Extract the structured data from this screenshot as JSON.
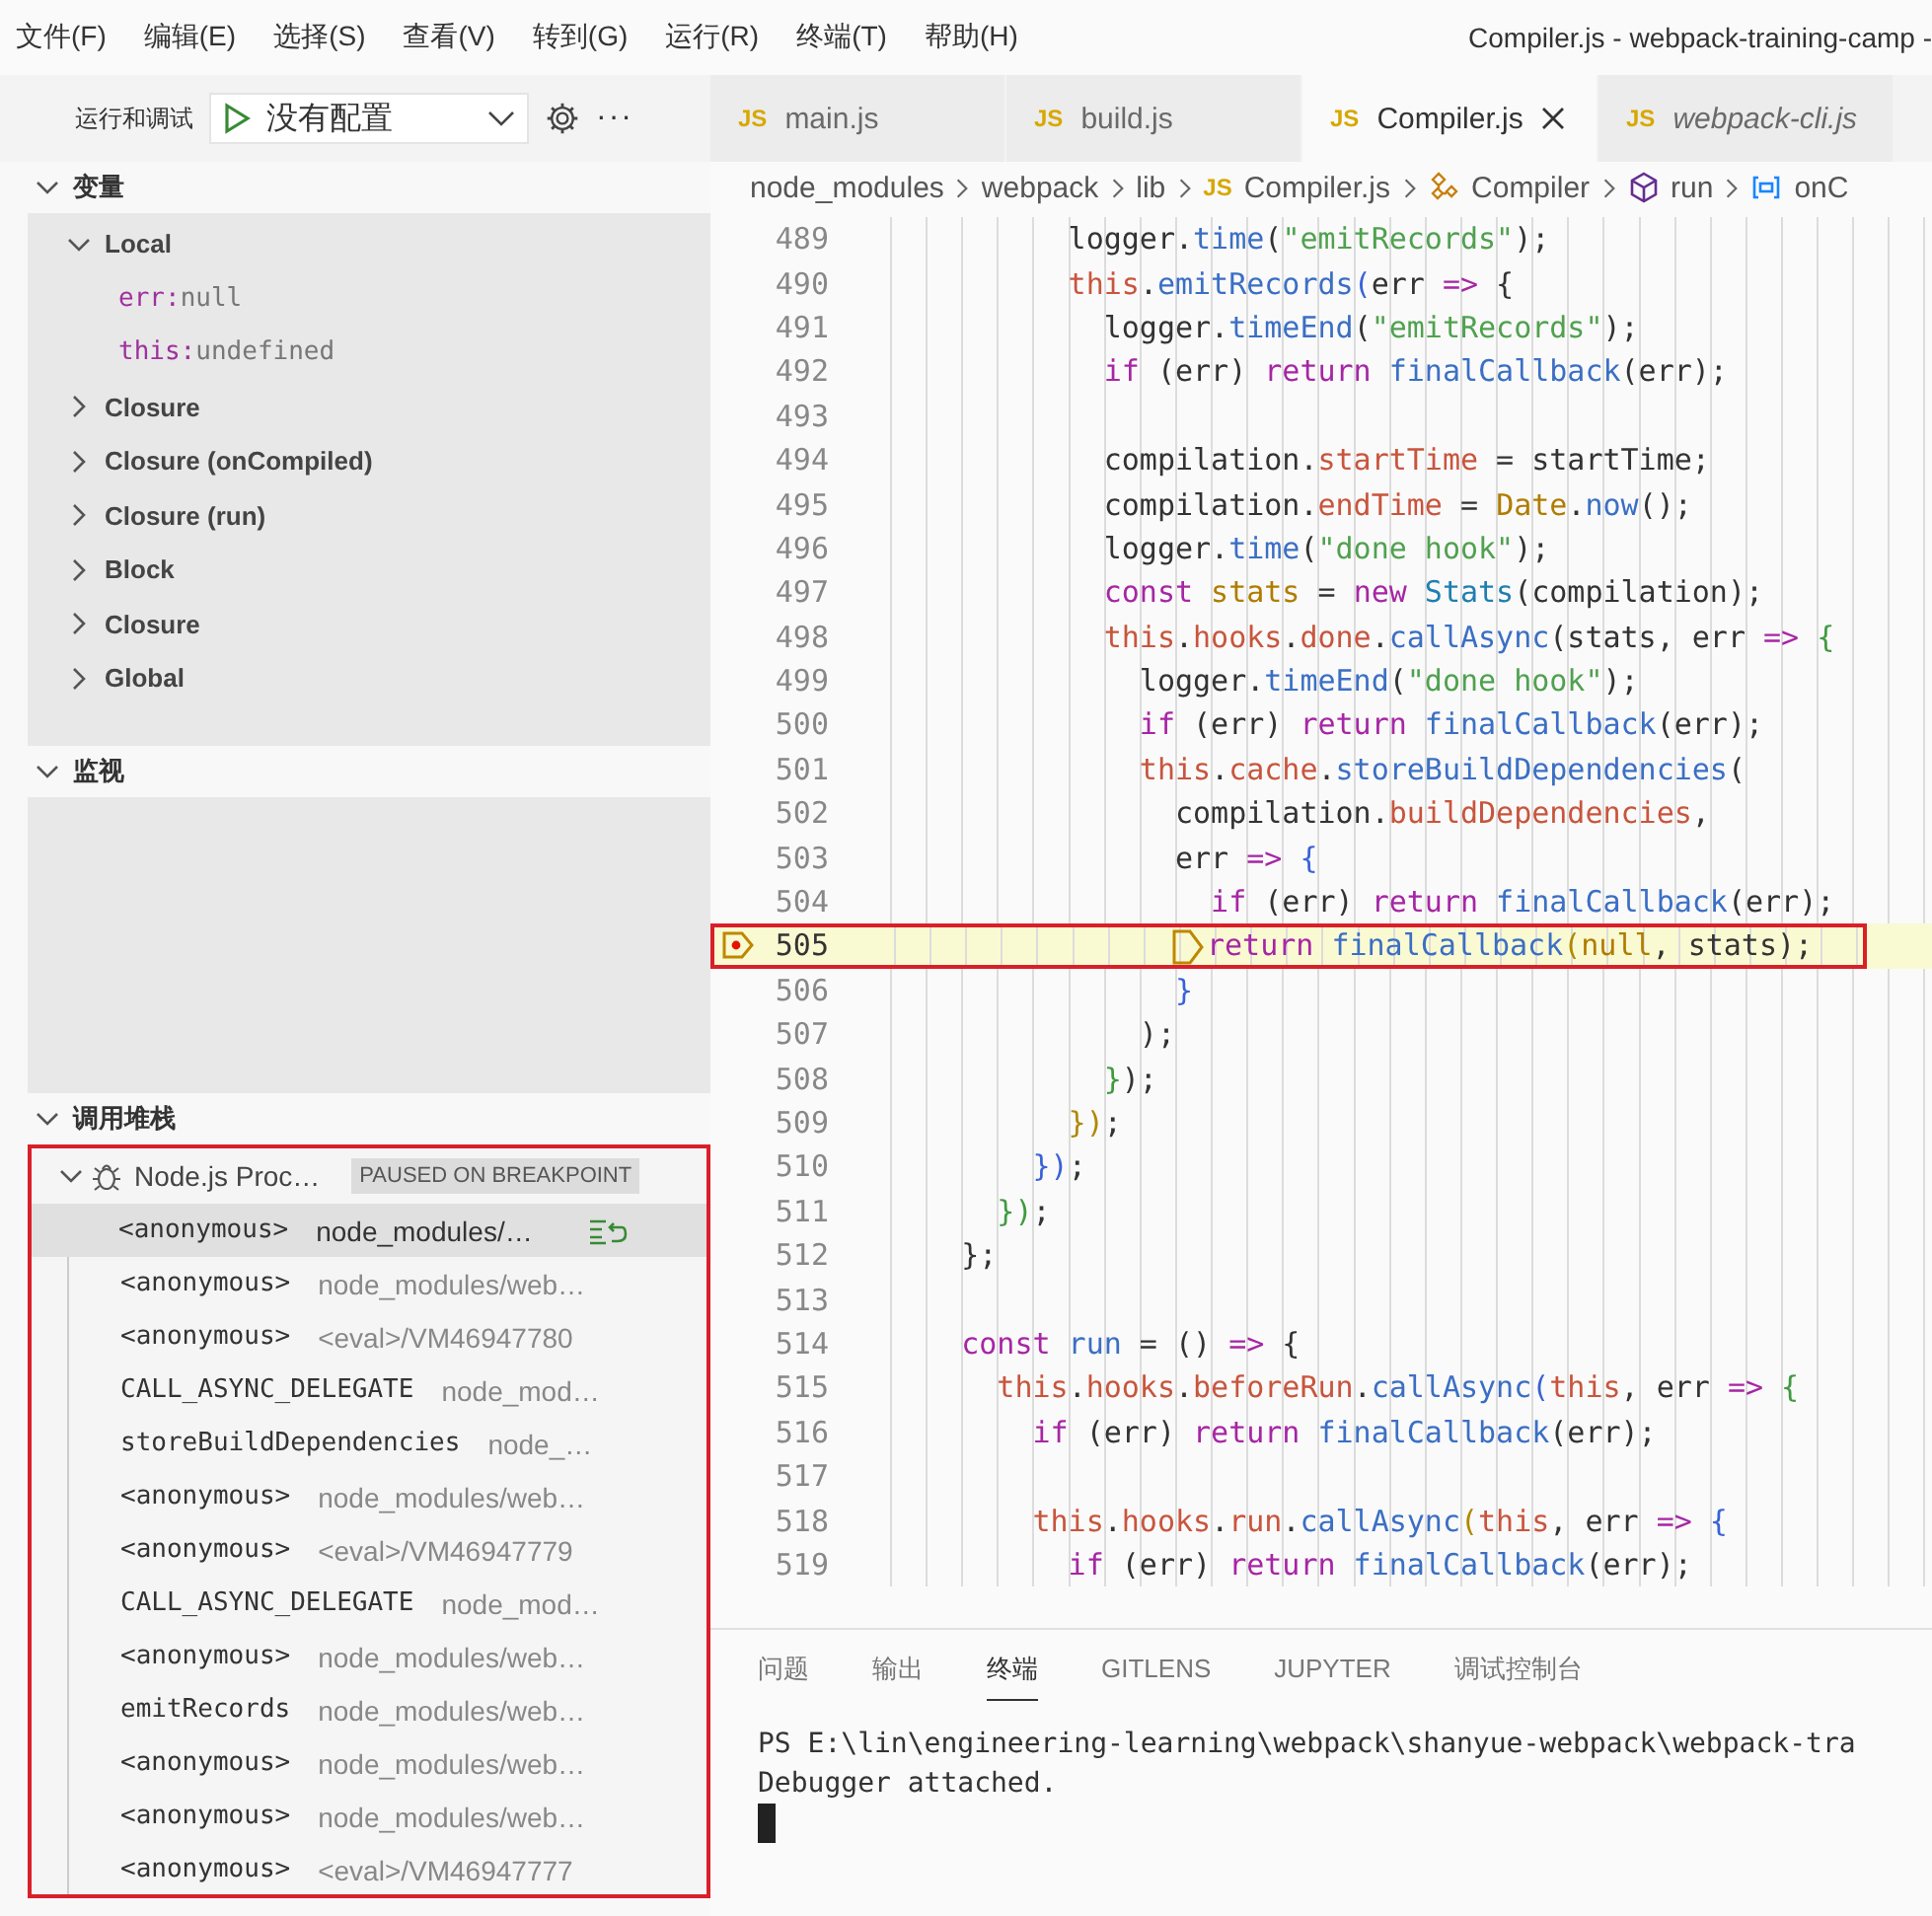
{
  "menu_bar": {
    "items": [
      "文件(F)",
      "编辑(E)",
      "选择(S)",
      "查看(V)",
      "转到(G)",
      "运行(R)",
      "终端(T)",
      "帮助(H)"
    ],
    "title": "Compiler.js - webpack-training-camp -"
  },
  "debug_toolbar": {
    "label": "运行和调试",
    "configuration": "没有配置",
    "more": "···"
  },
  "tabs": [
    {
      "badge": "JS",
      "label": "main.js",
      "selected": false,
      "preview": false
    },
    {
      "badge": "JS",
      "label": "build.js",
      "selected": false,
      "preview": false
    },
    {
      "badge": "JS",
      "label": "Compiler.js",
      "selected": true,
      "preview": false
    },
    {
      "badge": "JS",
      "label": "webpack-cli.js",
      "selected": false,
      "preview": true
    }
  ],
  "breadcrumbs": [
    {
      "kind": "folder",
      "label": "node_modules"
    },
    {
      "kind": "folder",
      "label": "webpack"
    },
    {
      "kind": "folder",
      "label": "lib"
    },
    {
      "kind": "file",
      "badge": "JS",
      "label": "Compiler.js"
    },
    {
      "kind": "class",
      "label": "Compiler"
    },
    {
      "kind": "method",
      "label": "run"
    },
    {
      "kind": "variable",
      "label": "onC"
    }
  ],
  "sidebar": {
    "variables": {
      "title": "变量",
      "expanded": true,
      "scopes": [
        {
          "label": "Local",
          "expanded": true,
          "children": [
            {
              "name": "err:",
              "value": "null"
            },
            {
              "name": "this:",
              "value": "undefined"
            }
          ]
        },
        {
          "label": "Closure",
          "expanded": false
        },
        {
          "label": "Closure (onCompiled)",
          "expanded": false
        },
        {
          "label": "Closure (run)",
          "expanded": false
        },
        {
          "label": "Block",
          "expanded": false
        },
        {
          "label": "Closure",
          "expanded": false
        },
        {
          "label": "Global",
          "expanded": false
        }
      ]
    },
    "watch": {
      "title": "监视",
      "expanded": true
    },
    "call_stack": {
      "title": "调用堆栈",
      "expanded": true,
      "session": {
        "label": "Node.js Proc…",
        "status": "PAUSED ON BREAKPOINT",
        "expanded": true
      },
      "frames": [
        {
          "name": "<anonymous>",
          "source": "node_modules/…",
          "selected": true
        },
        {
          "name": "<anonymous>",
          "source": "node_modules/web…",
          "selected": false
        },
        {
          "name": "<anonymous>",
          "source": "<eval>/VM46947780",
          "selected": false
        },
        {
          "name": "CALL_ASYNC_DELEGATE",
          "source": "node_mod…",
          "selected": false
        },
        {
          "name": "storeBuildDependencies",
          "source": "node_…",
          "selected": false
        },
        {
          "name": "<anonymous>",
          "source": "node_modules/web…",
          "selected": false
        },
        {
          "name": "<anonymous>",
          "source": "<eval>/VM46947779",
          "selected": false
        },
        {
          "name": "CALL_ASYNC_DELEGATE",
          "source": "node_mod…",
          "selected": false
        },
        {
          "name": "<anonymous>",
          "source": "node_modules/web…",
          "selected": false
        },
        {
          "name": "emitRecords",
          "source": "node_modules/web…",
          "selected": false
        },
        {
          "name": "<anonymous>",
          "source": "node_modules/web…",
          "selected": false
        },
        {
          "name": "<anonymous>",
          "source": "node_modules/web…",
          "selected": false
        },
        {
          "name": "<anonymous>",
          "source": "<eval>/VM46947777",
          "selected": false
        }
      ]
    }
  },
  "editor": {
    "lines": [
      {
        "no": "489",
        "current": false,
        "tokens": [
          {
            "text": "          logger.",
            "kind": "p"
          },
          {
            "text": "time",
            "kind": "f"
          },
          {
            "text": "(",
            "kind": "p"
          },
          {
            "text": "\"emitRecords\"",
            "kind": "s"
          },
          {
            "text": ");",
            "kind": "p"
          }
        ]
      },
      {
        "no": "490",
        "current": false,
        "tokens": [
          {
            "text": "          this",
            "kind": "t"
          },
          {
            "text": ".",
            "kind": "p"
          },
          {
            "text": "emitRecords",
            "kind": "f"
          },
          {
            "text": "(",
            "kind": "b"
          },
          {
            "text": "err ",
            "kind": "p"
          },
          {
            "text": "=>",
            "kind": "k"
          },
          {
            "text": " {",
            "kind": "p"
          }
        ]
      },
      {
        "no": "491",
        "current": false,
        "tokens": [
          {
            "text": "            logger.",
            "kind": "p"
          },
          {
            "text": "timeEnd",
            "kind": "f"
          },
          {
            "text": "(",
            "kind": "p"
          },
          {
            "text": "\"emitRecords\"",
            "kind": "s"
          },
          {
            "text": ");",
            "kind": "p"
          }
        ]
      },
      {
        "no": "492",
        "current": false,
        "tokens": [
          {
            "text": "            if",
            "kind": "k"
          },
          {
            "text": " (err) ",
            "kind": "p"
          },
          {
            "text": "return",
            "kind": "k"
          },
          {
            "text": " finalCallback",
            "kind": "f"
          },
          {
            "text": "(err);",
            "kind": "p"
          }
        ]
      },
      {
        "no": "493",
        "current": false
      },
      {
        "no": "494",
        "current": false,
        "tokens": [
          {
            "text": "            compilation.",
            "kind": "p"
          },
          {
            "text": "startTime",
            "kind": "t"
          },
          {
            "text": " = startTime;",
            "kind": "p"
          }
        ]
      },
      {
        "no": "495",
        "current": false,
        "tokens": [
          {
            "text": "            compilation.",
            "kind": "p"
          },
          {
            "text": "endTime",
            "kind": "t"
          },
          {
            "text": " = ",
            "kind": "p"
          },
          {
            "text": "Date",
            "kind": "c"
          },
          {
            "text": ".",
            "kind": "p"
          },
          {
            "text": "now",
            "kind": "f"
          },
          {
            "text": "();",
            "kind": "p"
          }
        ]
      },
      {
        "no": "496",
        "current": false,
        "tokens": [
          {
            "text": "            logger.",
            "kind": "p"
          },
          {
            "text": "time",
            "kind": "f"
          },
          {
            "text": "(",
            "kind": "p"
          },
          {
            "text": "\"done hook\"",
            "kind": "s"
          },
          {
            "text": ");",
            "kind": "p"
          }
        ]
      },
      {
        "no": "497",
        "current": false,
        "tokens": [
          {
            "text": "            const",
            "kind": "k"
          },
          {
            "text": " stats",
            "kind": "c"
          },
          {
            "text": " = ",
            "kind": "p"
          },
          {
            "text": "new",
            "kind": "k"
          },
          {
            "text": " Stats",
            "kind": "y"
          },
          {
            "text": "(compilation);",
            "kind": "p"
          }
        ]
      },
      {
        "no": "498",
        "current": false,
        "tokens": [
          {
            "text": "            this",
            "kind": "t"
          },
          {
            "text": ".",
            "kind": "p"
          },
          {
            "text": "hooks",
            "kind": "t"
          },
          {
            "text": ".",
            "kind": "p"
          },
          {
            "text": "done",
            "kind": "t"
          },
          {
            "text": ".",
            "kind": "p"
          },
          {
            "text": "callAsync",
            "kind": "f"
          },
          {
            "text": "(stats, err ",
            "kind": "p"
          },
          {
            "text": "=>",
            "kind": "k"
          },
          {
            "text": " {",
            "kind": "g"
          }
        ]
      },
      {
        "no": "499",
        "current": false,
        "tokens": [
          {
            "text": "              logger.",
            "kind": "p"
          },
          {
            "text": "timeEnd",
            "kind": "f"
          },
          {
            "text": "(",
            "kind": "p"
          },
          {
            "text": "\"done hook\"",
            "kind": "s"
          },
          {
            "text": ");",
            "kind": "p"
          }
        ]
      },
      {
        "no": "500",
        "current": false,
        "tokens": [
          {
            "text": "              if",
            "kind": "k"
          },
          {
            "text": " (err) ",
            "kind": "p"
          },
          {
            "text": "return",
            "kind": "k"
          },
          {
            "text": " finalCallback",
            "kind": "f"
          },
          {
            "text": "(err);",
            "kind": "p"
          }
        ]
      },
      {
        "no": "501",
        "current": false,
        "tokens": [
          {
            "text": "              this",
            "kind": "t"
          },
          {
            "text": ".",
            "kind": "p"
          },
          {
            "text": "cache",
            "kind": "t"
          },
          {
            "text": ".",
            "kind": "p"
          },
          {
            "text": "storeBuildDependencies",
            "kind": "f"
          },
          {
            "text": "(",
            "kind": "p"
          }
        ]
      },
      {
        "no": "502",
        "current": false,
        "tokens": [
          {
            "text": "                compilation.",
            "kind": "p"
          },
          {
            "text": "buildDependencies",
            "kind": "t"
          },
          {
            "text": ",",
            "kind": "p"
          }
        ]
      },
      {
        "no": "503",
        "current": false,
        "tokens": [
          {
            "text": "                err ",
            "kind": "p"
          },
          {
            "text": "=>",
            "kind": "k"
          },
          {
            "text": " {",
            "kind": "b"
          }
        ]
      },
      {
        "no": "504",
        "current": false,
        "tokens": [
          {
            "text": "                  if",
            "kind": "k"
          },
          {
            "text": " (err) ",
            "kind": "p"
          },
          {
            "text": "return",
            "kind": "k"
          },
          {
            "text": " finalCallback",
            "kind": "f"
          },
          {
            "text": "(err);",
            "kind": "p"
          }
        ]
      },
      {
        "no": "505",
        "current": true,
        "tokens": [
          {
            "text": "                return",
            "kind": "k"
          },
          {
            "text": " finalCallback",
            "kind": "f"
          },
          {
            "text": "(",
            "kind": "o"
          },
          {
            "text": "null",
            "kind": "c"
          },
          {
            "text": ", stats",
            "kind": "p"
          },
          {
            "text": ");",
            "kind": "p"
          }
        ]
      },
      {
        "no": "506",
        "current": false,
        "tokens": [
          {
            "text": "                }",
            "kind": "b"
          }
        ]
      },
      {
        "no": "507",
        "current": false,
        "tokens": [
          {
            "text": "              );",
            "kind": "p"
          }
        ]
      },
      {
        "no": "508",
        "current": false,
        "tokens": [
          {
            "text": "            }",
            "kind": "g"
          },
          {
            "text": ");",
            "kind": "p"
          }
        ]
      },
      {
        "no": "509",
        "current": false,
        "tokens": [
          {
            "text": "          })",
            "kind": "o"
          },
          {
            "text": ";",
            "kind": "p"
          }
        ]
      },
      {
        "no": "510",
        "current": false,
        "tokens": [
          {
            "text": "        })",
            "kind": "b"
          },
          {
            "text": ";",
            "kind": "p"
          }
        ]
      },
      {
        "no": "511",
        "current": false,
        "tokens": [
          {
            "text": "      })",
            "kind": "g"
          },
          {
            "text": ";",
            "kind": "p"
          }
        ]
      },
      {
        "no": "512",
        "current": false,
        "tokens": [
          {
            "text": "    };",
            "kind": "p"
          }
        ]
      },
      {
        "no": "513",
        "current": false
      },
      {
        "no": "514",
        "current": false,
        "tokens": [
          {
            "text": "    const",
            "kind": "k"
          },
          {
            "text": " run",
            "kind": "f"
          },
          {
            "text": " = () ",
            "kind": "p"
          },
          {
            "text": "=>",
            "kind": "k"
          },
          {
            "text": " {",
            "kind": "p"
          }
        ]
      },
      {
        "no": "515",
        "current": false,
        "tokens": [
          {
            "text": "      this",
            "kind": "t"
          },
          {
            "text": ".",
            "kind": "p"
          },
          {
            "text": "hooks",
            "kind": "t"
          },
          {
            "text": ".",
            "kind": "p"
          },
          {
            "text": "beforeRun",
            "kind": "t"
          },
          {
            "text": ".",
            "kind": "p"
          },
          {
            "text": "callAsync",
            "kind": "f"
          },
          {
            "text": "(",
            "kind": "b"
          },
          {
            "text": "this",
            "kind": "t"
          },
          {
            "text": ", err ",
            "kind": "p"
          },
          {
            "text": "=>",
            "kind": "k"
          },
          {
            "text": " {",
            "kind": "g"
          }
        ]
      },
      {
        "no": "516",
        "current": false,
        "tokens": [
          {
            "text": "        if",
            "kind": "k"
          },
          {
            "text": " (err) ",
            "kind": "p"
          },
          {
            "text": "return",
            "kind": "k"
          },
          {
            "text": " finalCallback",
            "kind": "f"
          },
          {
            "text": "(err);",
            "kind": "p"
          }
        ]
      },
      {
        "no": "517",
        "current": false
      },
      {
        "no": "518",
        "current": false,
        "tokens": [
          {
            "text": "        this",
            "kind": "t"
          },
          {
            "text": ".",
            "kind": "p"
          },
          {
            "text": "hooks",
            "kind": "t"
          },
          {
            "text": ".",
            "kind": "p"
          },
          {
            "text": "run",
            "kind": "t"
          },
          {
            "text": ".",
            "kind": "p"
          },
          {
            "text": "callAsync",
            "kind": "f"
          },
          {
            "text": "(",
            "kind": "o"
          },
          {
            "text": "this",
            "kind": "t"
          },
          {
            "text": ", err ",
            "kind": "p"
          },
          {
            "text": "=>",
            "kind": "k"
          },
          {
            "text": " {",
            "kind": "b"
          }
        ]
      },
      {
        "no": "519",
        "current": false,
        "tokens": [
          {
            "text": "          if",
            "kind": "k"
          },
          {
            "text": " (err) ",
            "kind": "p"
          },
          {
            "text": "return",
            "kind": "k"
          },
          {
            "text": " finalCallback",
            "kind": "f"
          },
          {
            "text": "(err);",
            "kind": "p"
          }
        ]
      }
    ]
  },
  "panel": {
    "tabs": [
      {
        "label": "问题",
        "selected": false
      },
      {
        "label": "输出",
        "selected": false
      },
      {
        "label": "终端",
        "selected": true
      },
      {
        "label": "GITLENS",
        "selected": false
      },
      {
        "label": "JUPYTER",
        "selected": false
      },
      {
        "label": "调试控制台",
        "selected": false
      }
    ],
    "terminal": [
      "PS E:\\lin\\engineering-learning\\webpack\\shanyue-webpack\\webpack-tra",
      "Debugger attached."
    ]
  }
}
